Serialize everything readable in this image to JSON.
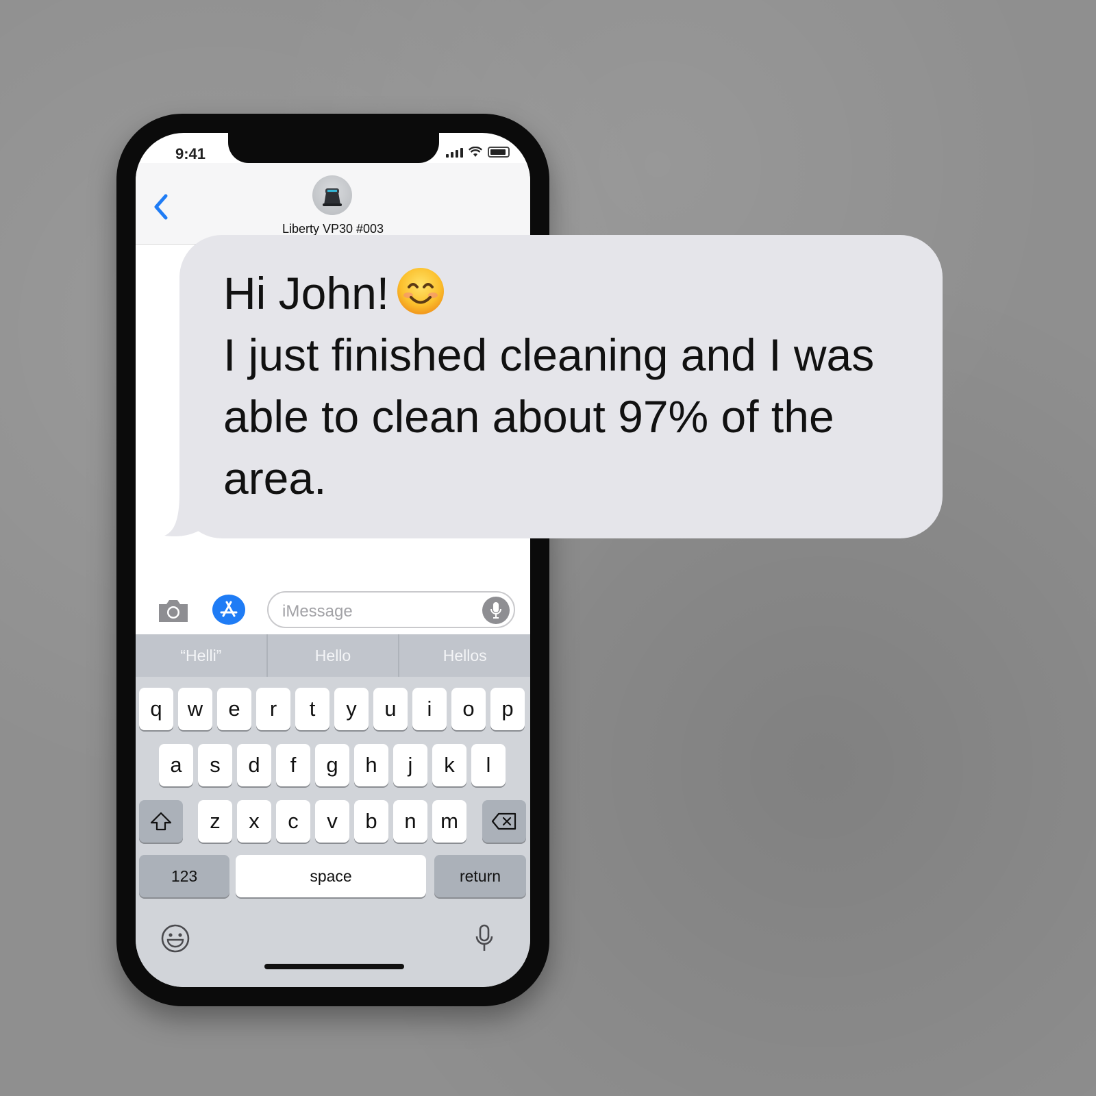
{
  "status_bar": {
    "time": "9:41"
  },
  "header": {
    "contact_name": "Liberty VP30 #003"
  },
  "message": {
    "greeting": "Hi John!",
    "emoji": "smiling-face-icon",
    "lines": [
      "I just finished cleaning and I was",
      "able to clean about 97% of the",
      "area."
    ]
  },
  "composer": {
    "placeholder": "iMessage"
  },
  "keyboard": {
    "suggestions": [
      "“Helli”",
      "Hello",
      "Hellos"
    ],
    "row1": [
      "q",
      "w",
      "e",
      "r",
      "t",
      "y",
      "u",
      "i",
      "o",
      "p"
    ],
    "row2": [
      "a",
      "s",
      "d",
      "f",
      "g",
      "h",
      "j",
      "k",
      "l"
    ],
    "row3": [
      "z",
      "x",
      "c",
      "v",
      "b",
      "n",
      "m"
    ],
    "numbers_label": "123",
    "space_label": "space",
    "return_label": "return"
  },
  "colors": {
    "accent": "#1f7cf5",
    "bubble": "#e5e5ea",
    "keyboard": "#d1d4d9"
  }
}
